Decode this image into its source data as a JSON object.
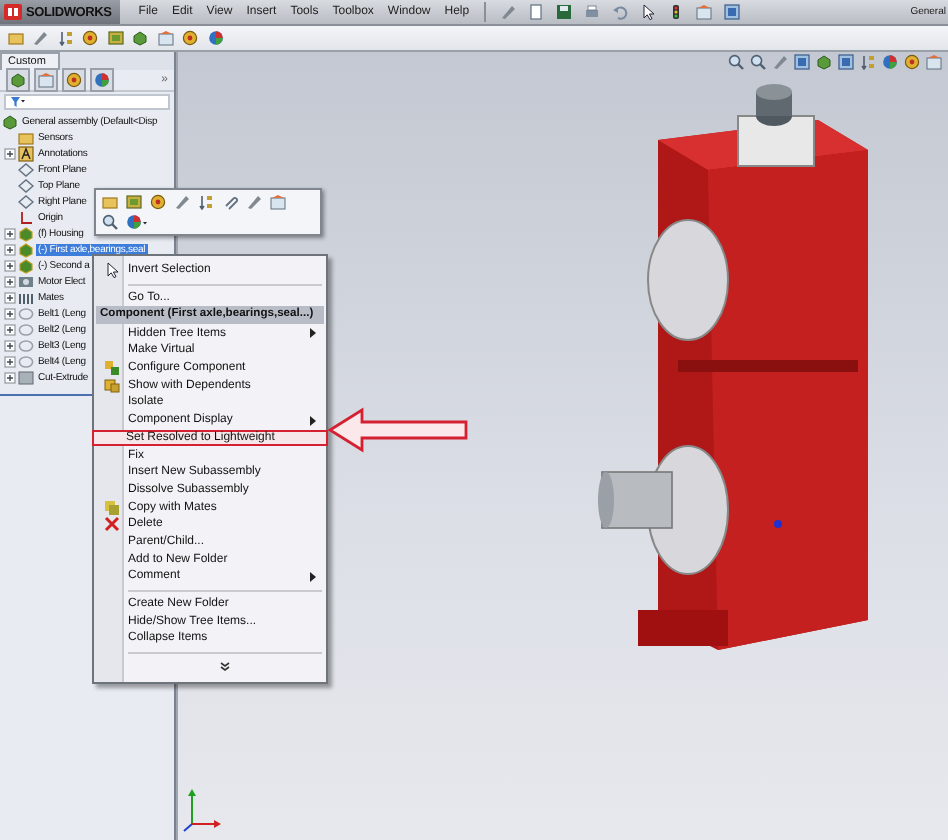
{
  "app": {
    "logo": "SOLIDWORKS",
    "menu": [
      "File",
      "Edit",
      "View",
      "Insert",
      "Tools",
      "Toolbox",
      "Window",
      "Help"
    ],
    "document_title": "General"
  },
  "feature_manager": {
    "tab": "Custom",
    "more": "»",
    "tree": [
      {
        "label": "General assembly (Default<Disp",
        "kind": "assembly",
        "expandable": false,
        "selected": false,
        "children": [
          {
            "label": "Sensors",
            "kind": "folder",
            "expandable": false,
            "selected": false
          },
          {
            "label": "Annotations",
            "kind": "annotation",
            "expandable": true,
            "selected": false
          },
          {
            "label": "Front Plane",
            "kind": "plane",
            "expandable": false,
            "selected": false
          },
          {
            "label": "Top Plane",
            "kind": "plane",
            "expandable": false,
            "selected": false
          },
          {
            "label": "Right Plane",
            "kind": "plane",
            "expandable": false,
            "selected": false
          },
          {
            "label": "Origin",
            "kind": "origin",
            "expandable": false,
            "selected": false
          },
          {
            "label": "(f) Housing",
            "kind": "part",
            "expandable": true,
            "selected": false
          },
          {
            "label": "(-) First axle,bearings,seal",
            "kind": "part",
            "expandable": true,
            "selected": true
          },
          {
            "label": "(-) Second a",
            "kind": "part",
            "expandable": true,
            "selected": false
          },
          {
            "label": "Motor Elect",
            "kind": "motor",
            "expandable": true,
            "selected": false
          },
          {
            "label": "Mates",
            "kind": "mates",
            "expandable": true,
            "selected": false
          },
          {
            "label": "Belt1 (Leng",
            "kind": "belt",
            "expandable": true,
            "selected": false
          },
          {
            "label": "Belt2 (Leng",
            "kind": "belt",
            "expandable": true,
            "selected": false
          },
          {
            "label": "Belt3 (Leng",
            "kind": "belt",
            "expandable": true,
            "selected": false
          },
          {
            "label": "Belt4 (Leng",
            "kind": "belt",
            "expandable": true,
            "selected": false
          },
          {
            "label": "Cut-Extrude",
            "kind": "cut",
            "expandable": true,
            "selected": false
          }
        ]
      }
    ]
  },
  "context_menu": {
    "items": [
      {
        "kind": "item",
        "label": "Invert Selection",
        "submenu": false,
        "highlighted": false
      },
      {
        "kind": "separator"
      },
      {
        "kind": "item",
        "label": "Go To...",
        "submenu": false,
        "highlighted": false
      },
      {
        "kind": "header",
        "label": "Component (First axle,bearings,seal...)"
      },
      {
        "kind": "item",
        "label": "Hidden Tree Items",
        "submenu": true,
        "highlighted": false
      },
      {
        "kind": "item",
        "label": "Make Virtual",
        "submenu": false,
        "highlighted": false
      },
      {
        "kind": "item",
        "label": "Configure Component",
        "submenu": false,
        "highlighted": false
      },
      {
        "kind": "item",
        "label": "Show with Dependents",
        "submenu": false,
        "highlighted": false
      },
      {
        "kind": "item",
        "label": "Isolate",
        "submenu": false,
        "highlighted": false
      },
      {
        "kind": "item",
        "label": "Component Display",
        "submenu": true,
        "highlighted": false
      },
      {
        "kind": "item",
        "label": "Set Resolved to Lightweight",
        "submenu": false,
        "highlighted": true
      },
      {
        "kind": "item",
        "label": "Fix",
        "submenu": false,
        "highlighted": false
      },
      {
        "kind": "item",
        "label": "Insert New Subassembly",
        "submenu": false,
        "highlighted": false
      },
      {
        "kind": "item",
        "label": "Dissolve Subassembly",
        "submenu": false,
        "highlighted": false
      },
      {
        "kind": "item",
        "label": "Copy with Mates",
        "submenu": false,
        "highlighted": false
      },
      {
        "kind": "item",
        "label": "Delete",
        "submenu": false,
        "highlighted": false
      },
      {
        "kind": "item",
        "label": "Parent/Child...",
        "submenu": false,
        "highlighted": false
      },
      {
        "kind": "item",
        "label": "Add to New Folder",
        "submenu": false,
        "highlighted": false
      },
      {
        "kind": "item",
        "label": "Comment",
        "submenu": true,
        "highlighted": false
      },
      {
        "kind": "separator"
      },
      {
        "kind": "item",
        "label": "Create New Folder",
        "submenu": false,
        "highlighted": false
      },
      {
        "kind": "item",
        "label": "Hide/Show Tree Items...",
        "submenu": false,
        "highlighted": false
      },
      {
        "kind": "item",
        "label": "Collapse Items",
        "submenu": false,
        "highlighted": false
      },
      {
        "kind": "separator"
      },
      {
        "kind": "expand"
      }
    ]
  }
}
